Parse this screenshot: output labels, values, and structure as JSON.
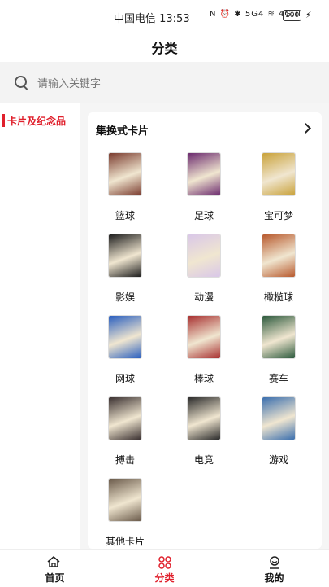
{
  "status_bar": {
    "carrier_time": "中国电信 13:53",
    "icons": "N ⏰ ✱ 5G4 ≋ 4G.ıl",
    "battery": "100",
    "charging": "⚡"
  },
  "header": {
    "title": "分类"
  },
  "search": {
    "placeholder": "请输入关键字"
  },
  "sidebar": {
    "items": [
      {
        "label": "卡片及纪念品",
        "active": true
      }
    ]
  },
  "section": {
    "title": "集换式卡片"
  },
  "grid": {
    "items": [
      {
        "label": "篮球",
        "color": "#7a3b2e"
      },
      {
        "label": "足球",
        "color": "#6b2a6e"
      },
      {
        "label": "宝可梦",
        "color": "#c9a23a"
      },
      {
        "label": "影娱",
        "color": "#1e1e1e"
      },
      {
        "label": "动漫",
        "color": "#d9c7e8"
      },
      {
        "label": "橄榄球",
        "color": "#b85a2e"
      },
      {
        "label": "网球",
        "color": "#2a5fbf"
      },
      {
        "label": "棒球",
        "color": "#a83030"
      },
      {
        "label": "赛车",
        "color": "#2d5a3d"
      },
      {
        "label": "搏击",
        "color": "#3a3030"
      },
      {
        "label": "电竞",
        "color": "#2a2a2a"
      },
      {
        "label": "游戏",
        "color": "#3b6fae"
      },
      {
        "label": "其他卡片",
        "color": "#6a5a4a"
      }
    ]
  },
  "tabbar": {
    "tabs": [
      {
        "label": "首页",
        "active": false
      },
      {
        "label": "分类",
        "active": true
      },
      {
        "label": "我的",
        "active": false
      }
    ],
    "active_color": "#e0202c"
  }
}
